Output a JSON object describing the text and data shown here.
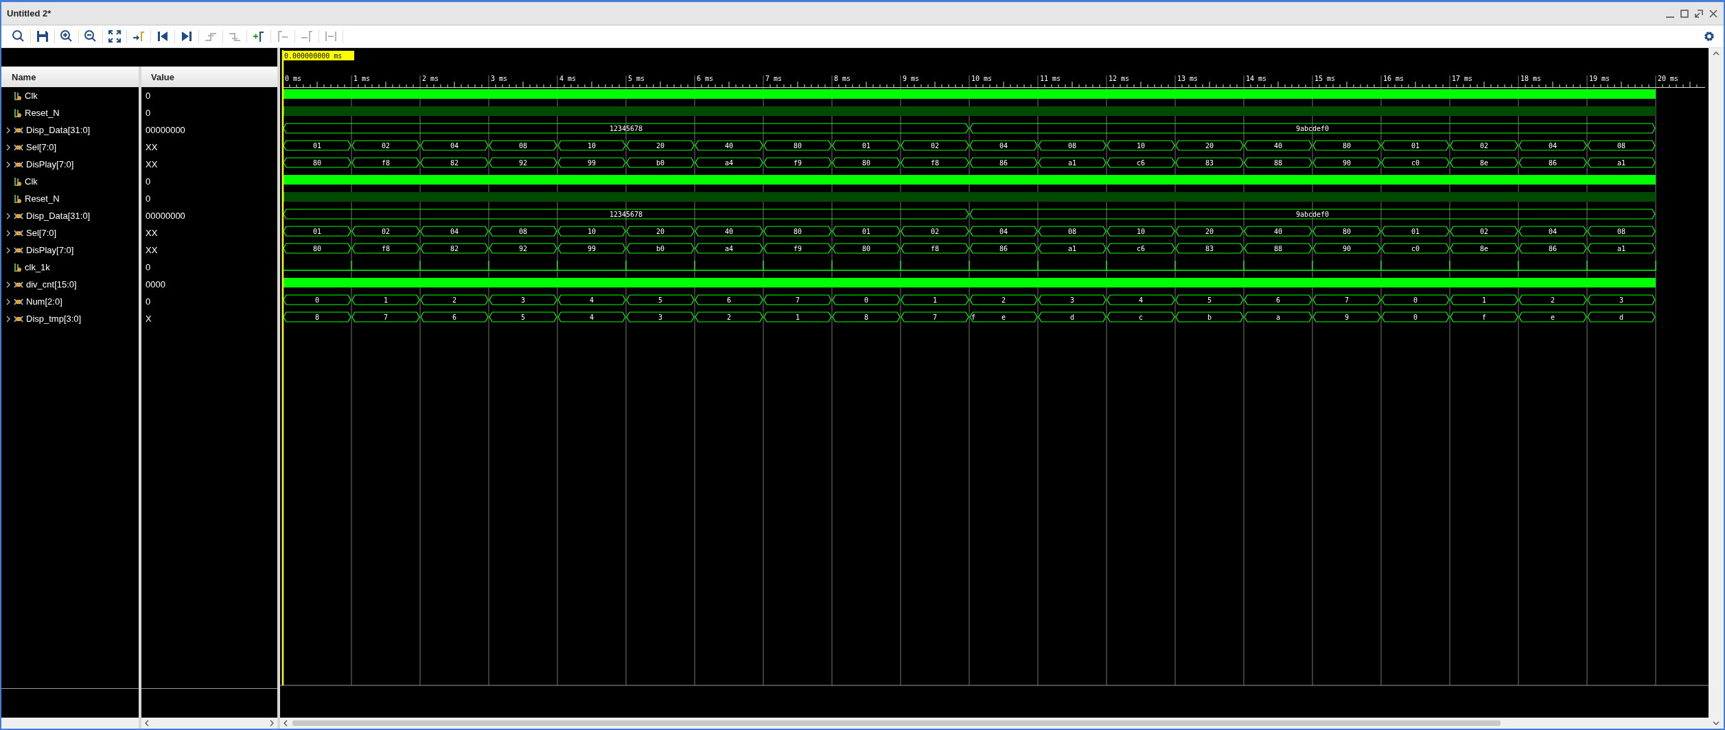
{
  "window": {
    "title": "Untitled 2*"
  },
  "toolbar": [
    {
      "kind": "search",
      "disabled": false
    },
    {
      "kind": "save",
      "disabled": false
    },
    {
      "kind": "zoom-in",
      "disabled": false
    },
    {
      "kind": "zoom-out",
      "disabled": false
    },
    {
      "kind": "zoom-fit",
      "disabled": false
    },
    {
      "kind": "go-to-cursor",
      "disabled": false
    },
    {
      "kind": "go-to-start",
      "disabled": false
    },
    {
      "kind": "go-to-end",
      "disabled": false
    },
    {
      "kind": "previous-transition",
      "disabled": true
    },
    {
      "kind": "next-transition",
      "disabled": true
    },
    {
      "kind": "add-marker",
      "disabled": false
    },
    {
      "kind": "previous-marker",
      "disabled": true
    },
    {
      "kind": "next-marker",
      "disabled": true
    },
    {
      "kind": "swap-cursors",
      "disabled": true
    }
  ],
  "columns": {
    "name": "Name",
    "value": "Value"
  },
  "cursor": {
    "label": "0.000000000 ms"
  },
  "time_labels": [
    "0 ms",
    "1 ms",
    "2 ms",
    "3 ms",
    "4 ms",
    "5 ms",
    "6 ms",
    "7 ms",
    "8 ms",
    "9 ms",
    "10 ms",
    "11 ms",
    "12 ms",
    "13 ms",
    "14 ms",
    "15 ms",
    "16 ms",
    "17 ms",
    "18 ms",
    "19 ms",
    "20 ms"
  ],
  "signals": [
    {
      "name": "Clk",
      "value": "0",
      "kind": "bit",
      "wave": {
        "kind": "dense"
      }
    },
    {
      "name": "Reset_N",
      "value": "0",
      "kind": "bit",
      "wave": {
        "kind": "dim"
      }
    },
    {
      "name": "Disp_Data[31:0]",
      "value": "00000000",
      "kind": "bus",
      "expanded": false,
      "wave": {
        "kind": "bus",
        "segments": [
          {
            "value": "12345678"
          },
          {
            "value": "9abcdef0"
          }
        ]
      }
    },
    {
      "name": "Sel[7:0]",
      "value": "XX",
      "kind": "bus",
      "expanded": false,
      "wave": {
        "kind": "bus",
        "segments": [
          {
            "value": "01"
          },
          {
            "value": "02"
          },
          {
            "value": "04"
          },
          {
            "value": "08"
          },
          {
            "value": "10"
          },
          {
            "value": "20"
          },
          {
            "value": "40"
          },
          {
            "value": "80"
          },
          {
            "value": "01"
          },
          {
            "value": "02"
          },
          {
            "value": "04"
          },
          {
            "value": "08"
          },
          {
            "value": "10"
          },
          {
            "value": "20"
          },
          {
            "value": "40"
          },
          {
            "value": "80"
          },
          {
            "value": "01"
          },
          {
            "value": "02"
          },
          {
            "value": "04"
          },
          {
            "value": "08"
          }
        ]
      }
    },
    {
      "name": "DisPlay[7:0]",
      "value": "XX",
      "kind": "bus",
      "expanded": false,
      "wave": {
        "kind": "bus",
        "segments": [
          {
            "value": "80"
          },
          {
            "value": "f8"
          },
          {
            "value": "82"
          },
          {
            "value": "92"
          },
          {
            "value": "99"
          },
          {
            "value": "b0"
          },
          {
            "value": "a4"
          },
          {
            "value": "f9"
          },
          {
            "value": "80"
          },
          {
            "value": "f8"
          },
          {
            "value": "86"
          },
          {
            "value": "a1"
          },
          {
            "value": "c6"
          },
          {
            "value": "83"
          },
          {
            "value": "88"
          },
          {
            "value": "90"
          },
          {
            "value": "c0"
          },
          {
            "value": "8e"
          },
          {
            "value": "86"
          },
          {
            "value": "a1"
          }
        ]
      }
    },
    {
      "name": "Clk",
      "value": "0",
      "kind": "bit",
      "wave": {
        "kind": "dense"
      }
    },
    {
      "name": "Reset_N",
      "value": "0",
      "kind": "bit",
      "wave": {
        "kind": "dim"
      }
    },
    {
      "name": "Disp_Data[31:0]",
      "value": "00000000",
      "kind": "bus",
      "expanded": false,
      "wave": {
        "kind": "bus",
        "segments": [
          {
            "value": "12345678"
          },
          {
            "value": "9abcdef0"
          }
        ]
      }
    },
    {
      "name": "Sel[7:0]",
      "value": "XX",
      "kind": "bus",
      "expanded": false,
      "wave": {
        "kind": "bus",
        "segments": [
          {
            "value": "01"
          },
          {
            "value": "02"
          },
          {
            "value": "04"
          },
          {
            "value": "08"
          },
          {
            "value": "10"
          },
          {
            "value": "20"
          },
          {
            "value": "40"
          },
          {
            "value": "80"
          },
          {
            "value": "01"
          },
          {
            "value": "02"
          },
          {
            "value": "04"
          },
          {
            "value": "08"
          },
          {
            "value": "10"
          },
          {
            "value": "20"
          },
          {
            "value": "40"
          },
          {
            "value": "80"
          },
          {
            "value": "01"
          },
          {
            "value": "02"
          },
          {
            "value": "04"
          },
          {
            "value": "08"
          }
        ]
      }
    },
    {
      "name": "DisPlay[7:0]",
      "value": "XX",
      "kind": "bus",
      "expanded": false,
      "wave": {
        "kind": "bus",
        "segments": [
          {
            "value": "80"
          },
          {
            "value": "f8"
          },
          {
            "value": "82"
          },
          {
            "value": "92"
          },
          {
            "value": "99"
          },
          {
            "value": "b0"
          },
          {
            "value": "a4"
          },
          {
            "value": "f9"
          },
          {
            "value": "80"
          },
          {
            "value": "f8"
          },
          {
            "value": "86"
          },
          {
            "value": "a1"
          },
          {
            "value": "c6"
          },
          {
            "value": "83"
          },
          {
            "value": "88"
          },
          {
            "value": "90"
          },
          {
            "value": "c0"
          },
          {
            "value": "8e"
          },
          {
            "value": "86"
          },
          {
            "value": "a1"
          }
        ]
      }
    },
    {
      "name": "clk_1k",
      "value": "0",
      "kind": "bit",
      "wave": {
        "kind": "pulse"
      }
    },
    {
      "name": "div_cnt[15:0]",
      "value": "0000",
      "kind": "bus",
      "expanded": false,
      "wave": {
        "kind": "dense"
      }
    },
    {
      "name": "Num[2:0]",
      "value": "0",
      "kind": "bus",
      "expanded": false,
      "wave": {
        "kind": "bus",
        "segments": [
          {
            "value": "0"
          },
          {
            "value": "1"
          },
          {
            "value": "2"
          },
          {
            "value": "3"
          },
          {
            "value": "4"
          },
          {
            "value": "5"
          },
          {
            "value": "6"
          },
          {
            "value": "7"
          },
          {
            "value": "0"
          },
          {
            "value": "1"
          },
          {
            "value": "2"
          },
          {
            "value": "3"
          },
          {
            "value": "4"
          },
          {
            "value": "5"
          },
          {
            "value": "6"
          },
          {
            "value": "7"
          },
          {
            "value": "0"
          },
          {
            "value": "1"
          },
          {
            "value": "2"
          },
          {
            "value": "3"
          }
        ]
      }
    },
    {
      "name": "Disp_tmp[3:0]",
      "value": "X",
      "kind": "bus",
      "expanded": false,
      "wave": {
        "kind": "bus",
        "segments": [
          {
            "value": "8"
          },
          {
            "value": "7"
          },
          {
            "value": "6"
          },
          {
            "value": "5"
          },
          {
            "value": "4"
          },
          {
            "value": "3"
          },
          {
            "value": "2"
          },
          {
            "value": "1"
          },
          {
            "value": "8"
          },
          {
            "value": "7"
          },
          {
            "value": "e",
            "glitch": "f"
          },
          {
            "value": "d"
          },
          {
            "value": "c"
          },
          {
            "value": "b"
          },
          {
            "value": "a"
          },
          {
            "value": "9"
          },
          {
            "value": "0"
          },
          {
            "value": "f"
          },
          {
            "value": "e"
          },
          {
            "value": "d"
          }
        ]
      }
    }
  ]
}
